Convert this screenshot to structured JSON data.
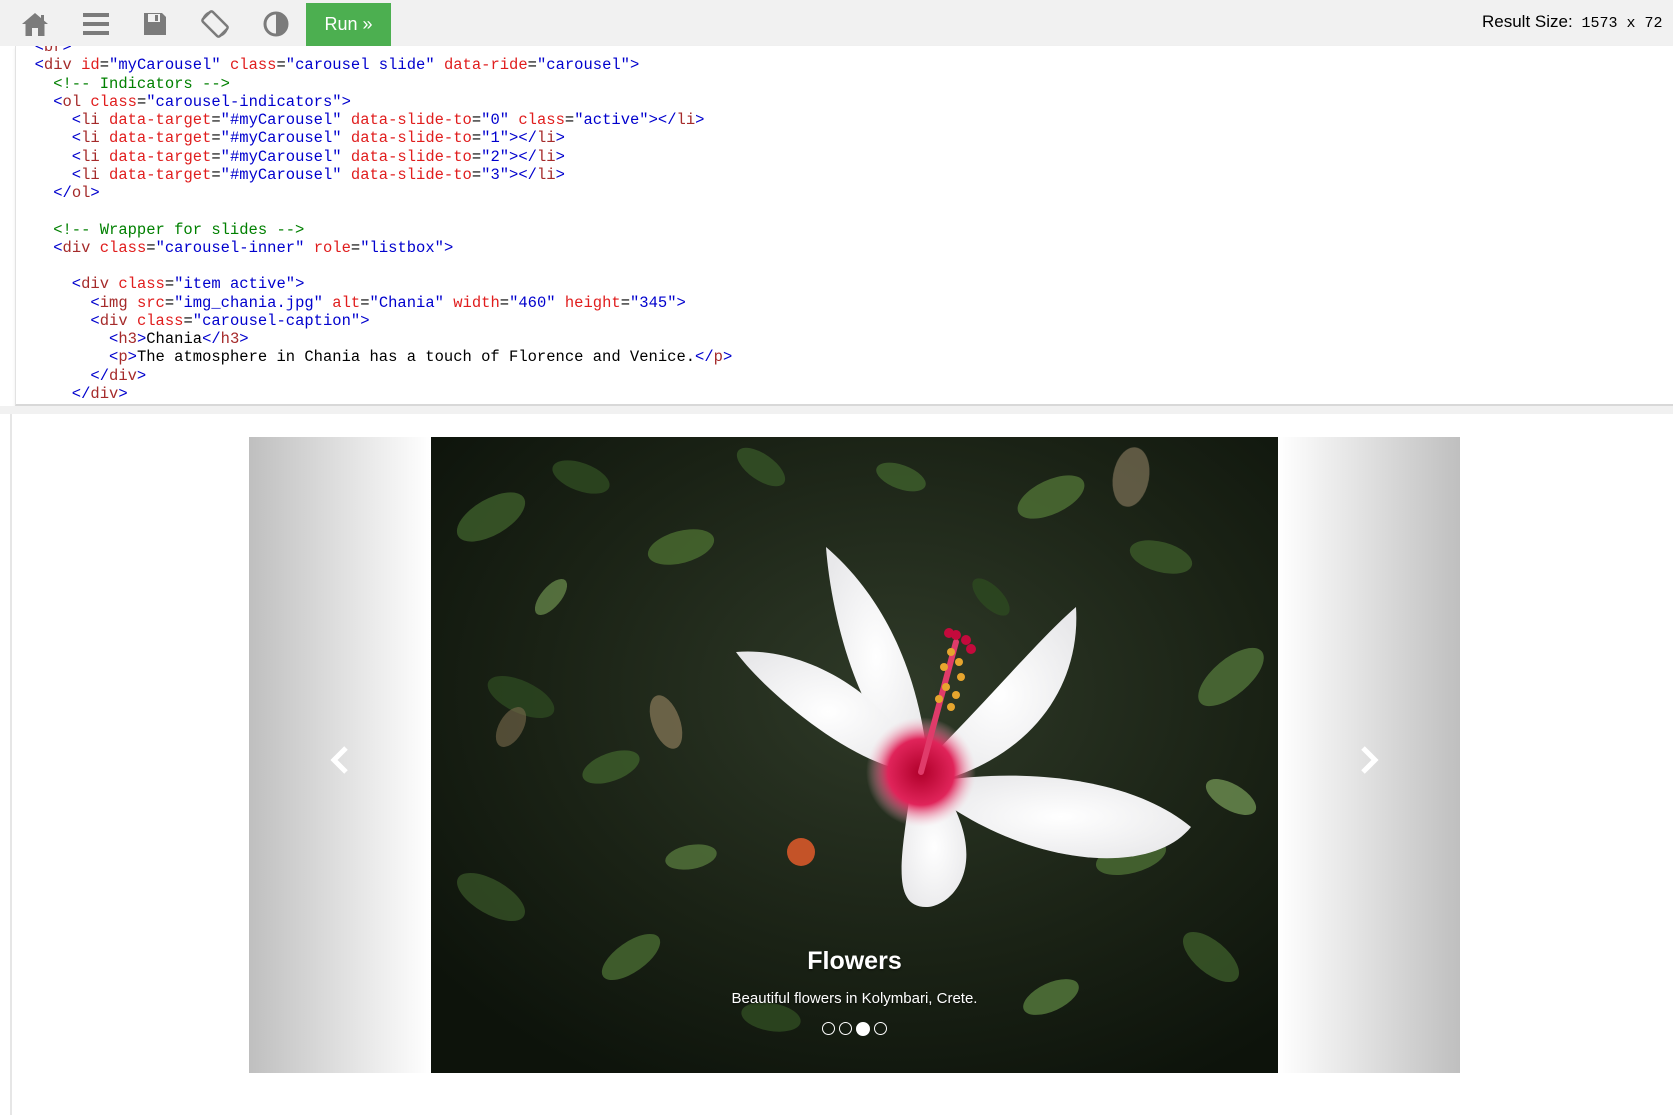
{
  "toolbar": {
    "icons": [
      "home-icon",
      "menu-icon",
      "save-icon",
      "rotate-icon",
      "contrast-icon"
    ],
    "run_label": "Run »",
    "result_size_label": "Result Size:",
    "result_size_value": "1573 x 72"
  },
  "editor": {
    "lines": [
      [
        {
          "c": "t-br",
          "t": "  <"
        },
        {
          "c": "t-tag",
          "t": "br"
        },
        {
          "c": "t-br",
          "t": ">"
        }
      ],
      [
        {
          "c": "t-br",
          "t": "  <"
        },
        {
          "c": "t-tag",
          "t": "div "
        },
        {
          "c": "t-attr",
          "t": "id"
        },
        {
          "c": "t-txt",
          "t": "="
        },
        {
          "c": "t-val",
          "t": "\"myCarousel\" "
        },
        {
          "c": "t-attr",
          "t": "class"
        },
        {
          "c": "t-txt",
          "t": "="
        },
        {
          "c": "t-val",
          "t": "\"carousel slide\" "
        },
        {
          "c": "t-attr",
          "t": "data-ride"
        },
        {
          "c": "t-txt",
          "t": "="
        },
        {
          "c": "t-val",
          "t": "\"carousel\""
        },
        {
          "c": "t-br",
          "t": ">"
        }
      ],
      [
        {
          "c": "t-com",
          "t": "    <!-- Indicators -->"
        }
      ],
      [
        {
          "c": "t-br",
          "t": "    <"
        },
        {
          "c": "t-tag",
          "t": "ol "
        },
        {
          "c": "t-attr",
          "t": "class"
        },
        {
          "c": "t-txt",
          "t": "="
        },
        {
          "c": "t-val",
          "t": "\"carousel-indicators\""
        },
        {
          "c": "t-br",
          "t": ">"
        }
      ],
      [
        {
          "c": "t-br",
          "t": "      <"
        },
        {
          "c": "t-tag",
          "t": "li "
        },
        {
          "c": "t-attr",
          "t": "data-target"
        },
        {
          "c": "t-txt",
          "t": "="
        },
        {
          "c": "t-val",
          "t": "\"#myCarousel\" "
        },
        {
          "c": "t-attr",
          "t": "data-slide-to"
        },
        {
          "c": "t-txt",
          "t": "="
        },
        {
          "c": "t-val",
          "t": "\"0\" "
        },
        {
          "c": "t-attr",
          "t": "class"
        },
        {
          "c": "t-txt",
          "t": "="
        },
        {
          "c": "t-val",
          "t": "\"active\""
        },
        {
          "c": "t-br",
          "t": "></"
        },
        {
          "c": "t-tag",
          "t": "li"
        },
        {
          "c": "t-br",
          "t": ">"
        }
      ],
      [
        {
          "c": "t-br",
          "t": "      <"
        },
        {
          "c": "t-tag",
          "t": "li "
        },
        {
          "c": "t-attr",
          "t": "data-target"
        },
        {
          "c": "t-txt",
          "t": "="
        },
        {
          "c": "t-val",
          "t": "\"#myCarousel\" "
        },
        {
          "c": "t-attr",
          "t": "data-slide-to"
        },
        {
          "c": "t-txt",
          "t": "="
        },
        {
          "c": "t-val",
          "t": "\"1\""
        },
        {
          "c": "t-br",
          "t": "></"
        },
        {
          "c": "t-tag",
          "t": "li"
        },
        {
          "c": "t-br",
          "t": ">"
        }
      ],
      [
        {
          "c": "t-br",
          "t": "      <"
        },
        {
          "c": "t-tag",
          "t": "li "
        },
        {
          "c": "t-attr",
          "t": "data-target"
        },
        {
          "c": "t-txt",
          "t": "="
        },
        {
          "c": "t-val",
          "t": "\"#myCarousel\" "
        },
        {
          "c": "t-attr",
          "t": "data-slide-to"
        },
        {
          "c": "t-txt",
          "t": "="
        },
        {
          "c": "t-val",
          "t": "\"2\""
        },
        {
          "c": "t-br",
          "t": "></"
        },
        {
          "c": "t-tag",
          "t": "li"
        },
        {
          "c": "t-br",
          "t": ">"
        }
      ],
      [
        {
          "c": "t-br",
          "t": "      <"
        },
        {
          "c": "t-tag",
          "t": "li "
        },
        {
          "c": "t-attr",
          "t": "data-target"
        },
        {
          "c": "t-txt",
          "t": "="
        },
        {
          "c": "t-val",
          "t": "\"#myCarousel\" "
        },
        {
          "c": "t-attr",
          "t": "data-slide-to"
        },
        {
          "c": "t-txt",
          "t": "="
        },
        {
          "c": "t-val",
          "t": "\"3\""
        },
        {
          "c": "t-br",
          "t": "></"
        },
        {
          "c": "t-tag",
          "t": "li"
        },
        {
          "c": "t-br",
          "t": ">"
        }
      ],
      [
        {
          "c": "t-br",
          "t": "    </"
        },
        {
          "c": "t-tag",
          "t": "ol"
        },
        {
          "c": "t-br",
          "t": ">"
        }
      ],
      [],
      [
        {
          "c": "t-com",
          "t": "    <!-- Wrapper for slides -->"
        }
      ],
      [
        {
          "c": "t-br",
          "t": "    <"
        },
        {
          "c": "t-tag",
          "t": "div "
        },
        {
          "c": "t-attr",
          "t": "class"
        },
        {
          "c": "t-txt",
          "t": "="
        },
        {
          "c": "t-val",
          "t": "\"carousel-inner\" "
        },
        {
          "c": "t-attr",
          "t": "role"
        },
        {
          "c": "t-txt",
          "t": "="
        },
        {
          "c": "t-val",
          "t": "\"listbox\""
        },
        {
          "c": "t-br",
          "t": ">"
        }
      ],
      [],
      [
        {
          "c": "t-br",
          "t": "      <"
        },
        {
          "c": "t-tag",
          "t": "div "
        },
        {
          "c": "t-attr",
          "t": "class"
        },
        {
          "c": "t-txt",
          "t": "="
        },
        {
          "c": "t-val",
          "t": "\"item active\""
        },
        {
          "c": "t-br",
          "t": ">"
        }
      ],
      [
        {
          "c": "t-br",
          "t": "        <"
        },
        {
          "c": "t-tag",
          "t": "img "
        },
        {
          "c": "t-attr",
          "t": "src"
        },
        {
          "c": "t-txt",
          "t": "="
        },
        {
          "c": "t-val",
          "t": "\"img_chania.jpg\" "
        },
        {
          "c": "t-attr",
          "t": "alt"
        },
        {
          "c": "t-txt",
          "t": "="
        },
        {
          "c": "t-val",
          "t": "\"Chania\" "
        },
        {
          "c": "t-attr",
          "t": "width"
        },
        {
          "c": "t-txt",
          "t": "="
        },
        {
          "c": "t-val",
          "t": "\"460\" "
        },
        {
          "c": "t-attr",
          "t": "height"
        },
        {
          "c": "t-txt",
          "t": "="
        },
        {
          "c": "t-val",
          "t": "\"345\""
        },
        {
          "c": "t-br",
          "t": ">"
        }
      ],
      [
        {
          "c": "t-br",
          "t": "        <"
        },
        {
          "c": "t-tag",
          "t": "div "
        },
        {
          "c": "t-attr",
          "t": "class"
        },
        {
          "c": "t-txt",
          "t": "="
        },
        {
          "c": "t-val",
          "t": "\"carousel-caption\""
        },
        {
          "c": "t-br",
          "t": ">"
        }
      ],
      [
        {
          "c": "t-br",
          "t": "          <"
        },
        {
          "c": "t-tag",
          "t": "h3"
        },
        {
          "c": "t-br",
          "t": ">"
        },
        {
          "c": "t-txt",
          "t": "Chania"
        },
        {
          "c": "t-br",
          "t": "</"
        },
        {
          "c": "t-tag",
          "t": "h3"
        },
        {
          "c": "t-br",
          "t": ">"
        }
      ],
      [
        {
          "c": "t-br",
          "t": "          <"
        },
        {
          "c": "t-tag",
          "t": "p"
        },
        {
          "c": "t-br",
          "t": ">"
        },
        {
          "c": "t-txt",
          "t": "The atmosphere in Chania has a touch of Florence and Venice."
        },
        {
          "c": "t-br",
          "t": "</"
        },
        {
          "c": "t-tag",
          "t": "p"
        },
        {
          "c": "t-br",
          "t": ">"
        }
      ],
      [
        {
          "c": "t-br",
          "t": "        </"
        },
        {
          "c": "t-tag",
          "t": "div"
        },
        {
          "c": "t-br",
          "t": ">"
        }
      ],
      [
        {
          "c": "t-br",
          "t": "      </"
        },
        {
          "c": "t-tag",
          "t": "div"
        },
        {
          "c": "t-br",
          "t": ">"
        }
      ]
    ]
  },
  "carousel": {
    "caption_title": "Flowers",
    "caption_text": "Beautiful flowers in Kolymbari, Crete.",
    "indicator_count": 4,
    "active_index": 2,
    "prev_icon": "chevron-left-icon",
    "next_icon": "chevron-right-icon"
  },
  "colors": {
    "run_button": "#4caf50",
    "toolbar_bg": "#f1f1f1",
    "code_tag": "#a52a2a",
    "code_attr": "#e01d1d",
    "code_value": "#0000cd",
    "code_comment": "#008000"
  }
}
